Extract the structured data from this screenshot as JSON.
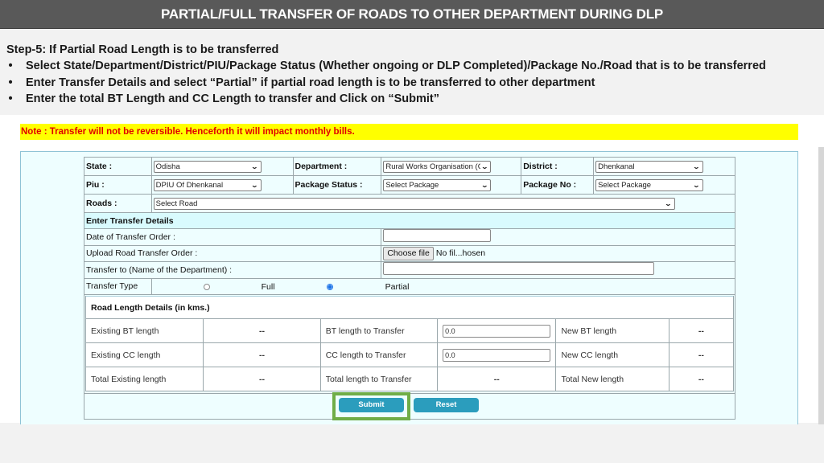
{
  "slide": {
    "title": "PARTIAL/FULL TRANSFER OF ROADS TO OTHER DEPARTMENT DURING DLP",
    "step_heading": "Step-5: If Partial Road Length is to be transferred",
    "bullet_glyph": "•",
    "bullets": [
      "Select State/Department/District/PIU/Package Status (Whether ongoing or DLP Completed)/Package No./Road that is to be transferred",
      "Enter Transfer Details and select “Partial” if partial road length is to be transferred to other department",
      "Enter the total BT Length and CC Length to transfer and Click on “Submit”"
    ]
  },
  "note": "Note : Transfer will not be reversible. Henceforth it will impact monthly bills.",
  "filters": {
    "state": {
      "label": "State :",
      "value": "Odisha"
    },
    "department": {
      "label": "Department :",
      "value": "Rural Works Organisation (C"
    },
    "district": {
      "label": "District :",
      "value": "Dhenkanal"
    },
    "piu": {
      "label": "Piu :",
      "value": "DPIU Of Dhenkanal"
    },
    "package_status": {
      "label": "Package Status :",
      "value": "Select Package"
    },
    "package_no": {
      "label": "Package No :",
      "value": "Select Package"
    },
    "roads": {
      "label": "Roads :",
      "value": "Select Road"
    },
    "chevron_glyph": "⌄"
  },
  "transfer_details": {
    "heading": "Enter Transfer Details",
    "date_label": "Date of Transfer Order :",
    "date_value": "",
    "upload_label": "Upload Road Transfer Order :",
    "choose_file_label": "Choose file",
    "file_status": "No fil...hosen",
    "transfer_to_label": "Transfer to (Name of the Department) :",
    "transfer_to_value": "",
    "transfer_type_label": "Transfer Type",
    "options": [
      {
        "label": "Full",
        "checked": false
      },
      {
        "label": "Partial",
        "checked": true
      }
    ]
  },
  "road_length": {
    "heading": "Road Length Details (in kms.)",
    "rows": [
      {
        "existing_label": "Existing BT length",
        "existing_value": "--",
        "transfer_label": "BT length to Transfer",
        "transfer_value": "0.0",
        "new_label": "New BT length",
        "new_value": "--"
      },
      {
        "existing_label": "Existing CC length",
        "existing_value": "--",
        "transfer_label": "CC length to Transfer",
        "transfer_value": "0.0",
        "new_label": "New CC length",
        "new_value": "--"
      },
      {
        "existing_label": "Total Existing length",
        "existing_value": "--",
        "transfer_label": "Total length to Transfer",
        "transfer_value": "--",
        "new_label": "Total New length",
        "new_value": "--"
      }
    ]
  },
  "actions": {
    "submit_label": "Submit",
    "reset_label": "Reset"
  },
  "colors": {
    "title_bar": "#595959",
    "note_bg": "#ffff00",
    "note_text": "#e00000",
    "button": "#2b9dbd",
    "highlight": "#70ad47",
    "section_bg": "#d9fbfe"
  }
}
